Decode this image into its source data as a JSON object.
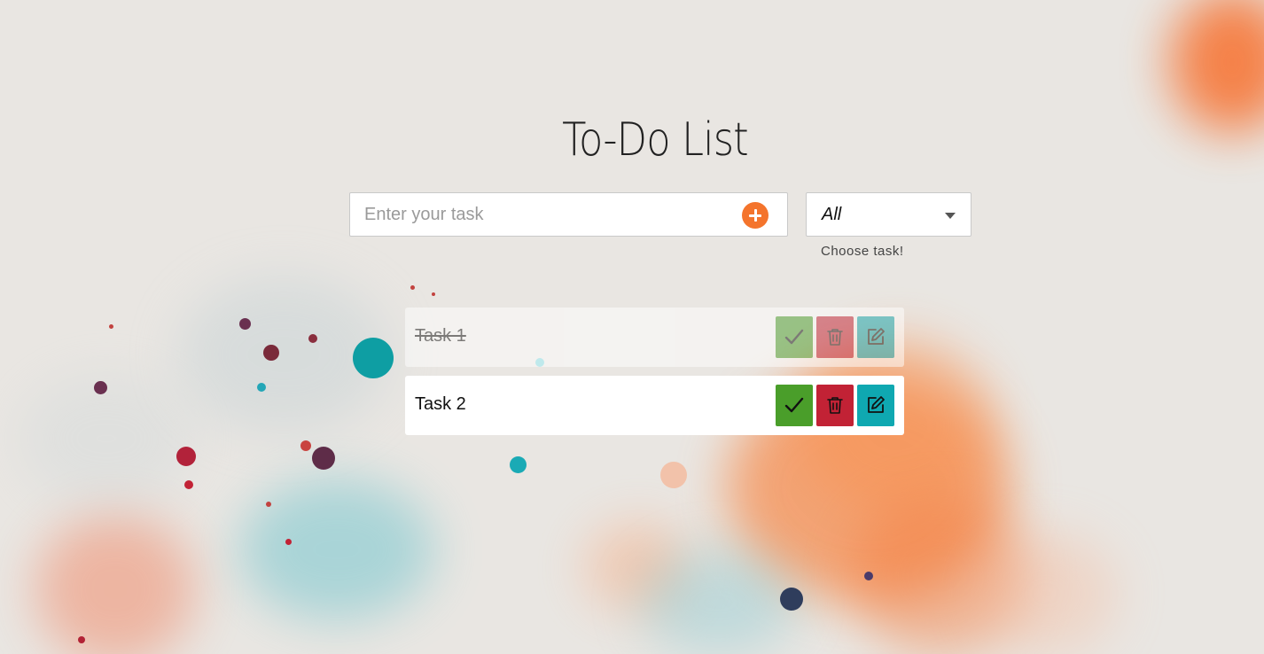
{
  "app": {
    "title": "To-Do List"
  },
  "form": {
    "input_placeholder": "Enter your task",
    "input_value": "",
    "add_icon": "plus-circle-icon"
  },
  "filter": {
    "selected": "All",
    "hint": "Choose task!"
  },
  "todos": [
    {
      "label": "Task 1",
      "completed": true
    },
    {
      "label": "Task 2",
      "completed": false
    }
  ],
  "actions": {
    "complete_icon": "check-icon",
    "delete_icon": "trash-icon",
    "edit_icon": "edit-icon"
  },
  "colors": {
    "accent": "#f4742c",
    "complete": "#4a9e2a",
    "delete": "#c22235",
    "edit": "#0fa8b1"
  }
}
